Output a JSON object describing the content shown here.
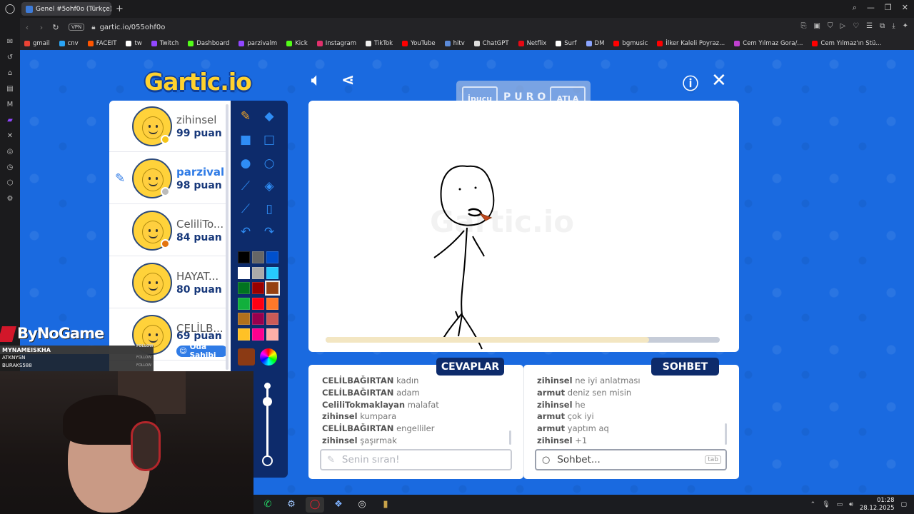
{
  "browser": {
    "tab_title": "Genel #5ohf0o (Türkçe)",
    "url": "gartic.io/055ohf0o",
    "vpn_label": "VPN",
    "bookmarks": [
      {
        "label": "gmail",
        "color": "#ea4335"
      },
      {
        "label": "cnv",
        "color": "#2aa4f4"
      },
      {
        "label": "FACEIT",
        "color": "#ff5500"
      },
      {
        "label": "tw",
        "color": "#ffffff"
      },
      {
        "label": "Twitch",
        "color": "#9146ff"
      },
      {
        "label": "Dashboard",
        "color": "#53fc18"
      },
      {
        "label": "parzivalm",
        "color": "#9146ff"
      },
      {
        "label": "Kick",
        "color": "#53fc18"
      },
      {
        "label": "Instagram",
        "color": "#e1306c"
      },
      {
        "label": "TikTok",
        "color": "#eeeeee"
      },
      {
        "label": "YouTube",
        "color": "#ff0000"
      },
      {
        "label": "hitv",
        "color": "#5b8ad8"
      },
      {
        "label": "ChatGPT",
        "color": "#dddddd"
      },
      {
        "label": "Netflix",
        "color": "#e50914"
      },
      {
        "label": "Surf",
        "color": "#ffffff"
      },
      {
        "label": "DM",
        "color": "#8aa4ff"
      },
      {
        "label": "bgmusic",
        "color": "#ff0000"
      },
      {
        "label": "İlker Kaleli Poyraz...",
        "color": "#ff0000"
      },
      {
        "label": "Cem Yılmaz Gora/...",
        "color": "#c040d0"
      },
      {
        "label": "Cem Yılmaz'ın Stü...",
        "color": "#ff0000"
      }
    ]
  },
  "game": {
    "logo": "Gartic.io",
    "hint_button": "İpucu",
    "hint_word": "PURO",
    "skip_button": "ATLA",
    "canvas_watermark": "Gartic.io",
    "timer_progress": 0.82,
    "players": [
      {
        "name": "zihinsel",
        "score": "99 puan",
        "status_color": "#f5c518",
        "drawing": false
      },
      {
        "name": "parzival",
        "score": "98 puan",
        "status_color": "#bbbbbb",
        "drawing": true
      },
      {
        "name": "CeliliTo...",
        "score": "84 puan",
        "status_color": "#e3740f",
        "drawing": false
      },
      {
        "name": "HAYAT...",
        "score": "80 puan",
        "status_color": "",
        "drawing": false
      },
      {
        "name": "CELİLB...",
        "score": "69 puan",
        "status_color": "",
        "drawing": false
      }
    ],
    "owner_badge": "Oda Sahibi",
    "palette": [
      "#000000",
      "#666666",
      "#0050cd",
      "#ffffff",
      "#aaaaaa",
      "#26c9ff",
      "#017420",
      "#990000",
      "#964112",
      "#11b03c",
      "#ff0013",
      "#ff7829",
      "#b0701c",
      "#99004e",
      "#cb5a57",
      "#ffc126",
      "#ff008f",
      "#feafa8"
    ],
    "current_color": "#8b3a14",
    "answers_title": "CEVAPLAR",
    "chat_title": "SOHBET",
    "answers": [
      {
        "user": "CELİLBAĞIRTAN",
        "text": "kadın"
      },
      {
        "user": "CELİLBAĞIRTAN",
        "text": "adam"
      },
      {
        "user": "CeliliTokmaklayan",
        "text": "malafat"
      },
      {
        "user": "zihinsel",
        "text": "kumpara"
      },
      {
        "user": "CELİLBAĞIRTAN",
        "text": "engelliler"
      },
      {
        "user": "zihinsel",
        "text": "şaşırmak"
      }
    ],
    "chat": [
      {
        "user": "zihinsel",
        "text": "ne iyi anlatması"
      },
      {
        "user": "armut",
        "text": "deniz sen misin"
      },
      {
        "user": "zihinsel",
        "text": "he"
      },
      {
        "user": "armut",
        "text": "çok iyi"
      },
      {
        "user": "armut",
        "text": "yaptım aq"
      },
      {
        "user": "zihinsel",
        "text": "+1"
      }
    ],
    "answer_placeholder": "Senin sıran!",
    "chat_placeholder": "Sohbet...",
    "chat_key_hint": "tab"
  },
  "overlay": {
    "sponsor": "ByNoGame",
    "follower_top": "MYNAMEISKHA",
    "follow_label": "FOLLOW",
    "followers": [
      "ATKNYSN",
      "BURAKS588"
    ],
    "follower_tags": [
      "FOLLOW",
      "FOLLOW"
    ]
  },
  "taskbar": {
    "time": "01:28",
    "date": "28.12.2025"
  }
}
